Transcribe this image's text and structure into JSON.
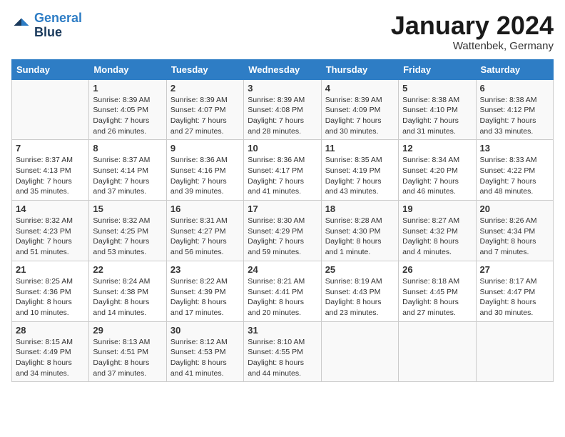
{
  "logo": {
    "line1": "General",
    "line2": "Blue"
  },
  "title": "January 2024",
  "location": "Wattenbek, Germany",
  "days_of_week": [
    "Sunday",
    "Monday",
    "Tuesday",
    "Wednesday",
    "Thursday",
    "Friday",
    "Saturday"
  ],
  "weeks": [
    [
      {
        "day": "",
        "sunrise": "",
        "sunset": "",
        "daylight": ""
      },
      {
        "day": "1",
        "sunrise": "Sunrise: 8:39 AM",
        "sunset": "Sunset: 4:05 PM",
        "daylight": "Daylight: 7 hours and 26 minutes."
      },
      {
        "day": "2",
        "sunrise": "Sunrise: 8:39 AM",
        "sunset": "Sunset: 4:07 PM",
        "daylight": "Daylight: 7 hours and 27 minutes."
      },
      {
        "day": "3",
        "sunrise": "Sunrise: 8:39 AM",
        "sunset": "Sunset: 4:08 PM",
        "daylight": "Daylight: 7 hours and 28 minutes."
      },
      {
        "day": "4",
        "sunrise": "Sunrise: 8:39 AM",
        "sunset": "Sunset: 4:09 PM",
        "daylight": "Daylight: 7 hours and 30 minutes."
      },
      {
        "day": "5",
        "sunrise": "Sunrise: 8:38 AM",
        "sunset": "Sunset: 4:10 PM",
        "daylight": "Daylight: 7 hours and 31 minutes."
      },
      {
        "day": "6",
        "sunrise": "Sunrise: 8:38 AM",
        "sunset": "Sunset: 4:12 PM",
        "daylight": "Daylight: 7 hours and 33 minutes."
      }
    ],
    [
      {
        "day": "7",
        "sunrise": "Sunrise: 8:37 AM",
        "sunset": "Sunset: 4:13 PM",
        "daylight": "Daylight: 7 hours and 35 minutes."
      },
      {
        "day": "8",
        "sunrise": "Sunrise: 8:37 AM",
        "sunset": "Sunset: 4:14 PM",
        "daylight": "Daylight: 7 hours and 37 minutes."
      },
      {
        "day": "9",
        "sunrise": "Sunrise: 8:36 AM",
        "sunset": "Sunset: 4:16 PM",
        "daylight": "Daylight: 7 hours and 39 minutes."
      },
      {
        "day": "10",
        "sunrise": "Sunrise: 8:36 AM",
        "sunset": "Sunset: 4:17 PM",
        "daylight": "Daylight: 7 hours and 41 minutes."
      },
      {
        "day": "11",
        "sunrise": "Sunrise: 8:35 AM",
        "sunset": "Sunset: 4:19 PM",
        "daylight": "Daylight: 7 hours and 43 minutes."
      },
      {
        "day": "12",
        "sunrise": "Sunrise: 8:34 AM",
        "sunset": "Sunset: 4:20 PM",
        "daylight": "Daylight: 7 hours and 46 minutes."
      },
      {
        "day": "13",
        "sunrise": "Sunrise: 8:33 AM",
        "sunset": "Sunset: 4:22 PM",
        "daylight": "Daylight: 7 hours and 48 minutes."
      }
    ],
    [
      {
        "day": "14",
        "sunrise": "Sunrise: 8:32 AM",
        "sunset": "Sunset: 4:23 PM",
        "daylight": "Daylight: 7 hours and 51 minutes."
      },
      {
        "day": "15",
        "sunrise": "Sunrise: 8:32 AM",
        "sunset": "Sunset: 4:25 PM",
        "daylight": "Daylight: 7 hours and 53 minutes."
      },
      {
        "day": "16",
        "sunrise": "Sunrise: 8:31 AM",
        "sunset": "Sunset: 4:27 PM",
        "daylight": "Daylight: 7 hours and 56 minutes."
      },
      {
        "day": "17",
        "sunrise": "Sunrise: 8:30 AM",
        "sunset": "Sunset: 4:29 PM",
        "daylight": "Daylight: 7 hours and 59 minutes."
      },
      {
        "day": "18",
        "sunrise": "Sunrise: 8:28 AM",
        "sunset": "Sunset: 4:30 PM",
        "daylight": "Daylight: 8 hours and 1 minute."
      },
      {
        "day": "19",
        "sunrise": "Sunrise: 8:27 AM",
        "sunset": "Sunset: 4:32 PM",
        "daylight": "Daylight: 8 hours and 4 minutes."
      },
      {
        "day": "20",
        "sunrise": "Sunrise: 8:26 AM",
        "sunset": "Sunset: 4:34 PM",
        "daylight": "Daylight: 8 hours and 7 minutes."
      }
    ],
    [
      {
        "day": "21",
        "sunrise": "Sunrise: 8:25 AM",
        "sunset": "Sunset: 4:36 PM",
        "daylight": "Daylight: 8 hours and 10 minutes."
      },
      {
        "day": "22",
        "sunrise": "Sunrise: 8:24 AM",
        "sunset": "Sunset: 4:38 PM",
        "daylight": "Daylight: 8 hours and 14 minutes."
      },
      {
        "day": "23",
        "sunrise": "Sunrise: 8:22 AM",
        "sunset": "Sunset: 4:39 PM",
        "daylight": "Daylight: 8 hours and 17 minutes."
      },
      {
        "day": "24",
        "sunrise": "Sunrise: 8:21 AM",
        "sunset": "Sunset: 4:41 PM",
        "daylight": "Daylight: 8 hours and 20 minutes."
      },
      {
        "day": "25",
        "sunrise": "Sunrise: 8:19 AM",
        "sunset": "Sunset: 4:43 PM",
        "daylight": "Daylight: 8 hours and 23 minutes."
      },
      {
        "day": "26",
        "sunrise": "Sunrise: 8:18 AM",
        "sunset": "Sunset: 4:45 PM",
        "daylight": "Daylight: 8 hours and 27 minutes."
      },
      {
        "day": "27",
        "sunrise": "Sunrise: 8:17 AM",
        "sunset": "Sunset: 4:47 PM",
        "daylight": "Daylight: 8 hours and 30 minutes."
      }
    ],
    [
      {
        "day": "28",
        "sunrise": "Sunrise: 8:15 AM",
        "sunset": "Sunset: 4:49 PM",
        "daylight": "Daylight: 8 hours and 34 minutes."
      },
      {
        "day": "29",
        "sunrise": "Sunrise: 8:13 AM",
        "sunset": "Sunset: 4:51 PM",
        "daylight": "Daylight: 8 hours and 37 minutes."
      },
      {
        "day": "30",
        "sunrise": "Sunrise: 8:12 AM",
        "sunset": "Sunset: 4:53 PM",
        "daylight": "Daylight: 8 hours and 41 minutes."
      },
      {
        "day": "31",
        "sunrise": "Sunrise: 8:10 AM",
        "sunset": "Sunset: 4:55 PM",
        "daylight": "Daylight: 8 hours and 44 minutes."
      },
      {
        "day": "",
        "sunrise": "",
        "sunset": "",
        "daylight": ""
      },
      {
        "day": "",
        "sunrise": "",
        "sunset": "",
        "daylight": ""
      },
      {
        "day": "",
        "sunrise": "",
        "sunset": "",
        "daylight": ""
      }
    ]
  ]
}
